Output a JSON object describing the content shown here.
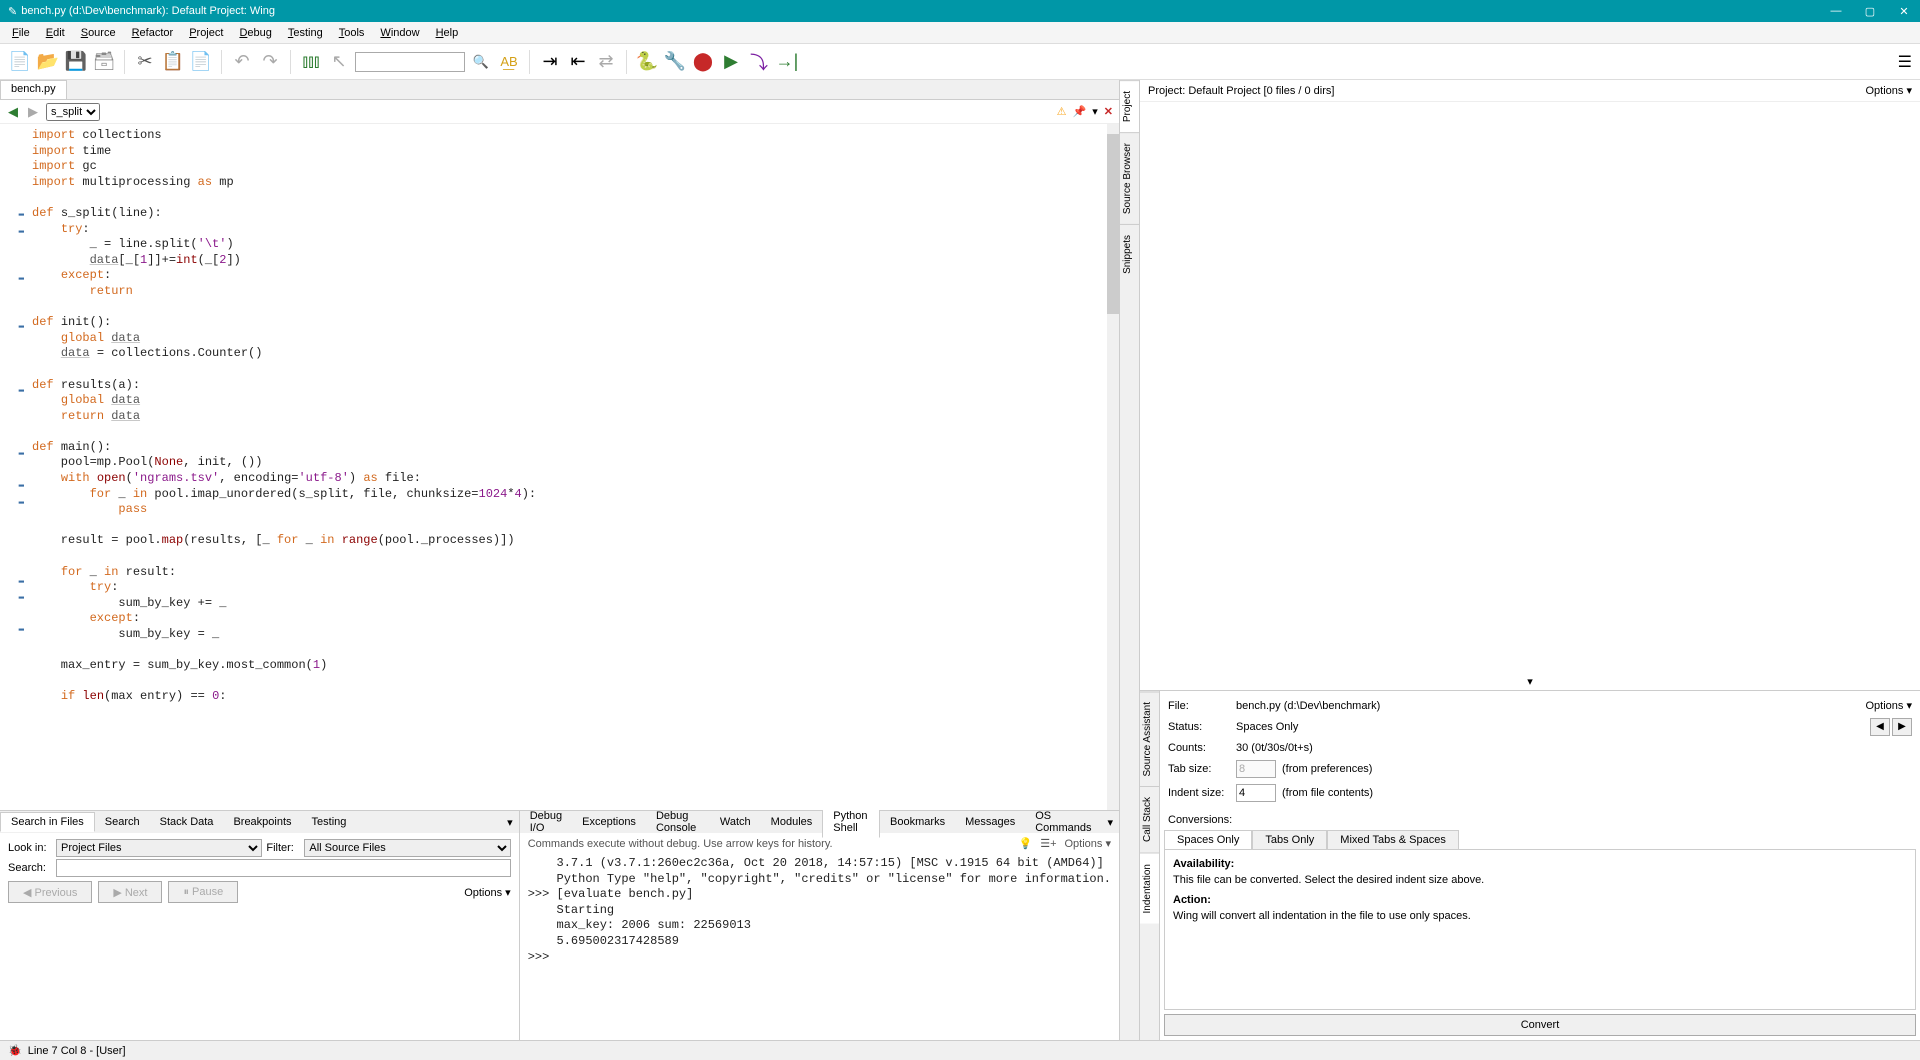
{
  "window": {
    "title": "bench.py (d:\\Dev\\benchmark): Default Project: Wing"
  },
  "menus": [
    "File",
    "Edit",
    "Source",
    "Refactor",
    "Project",
    "Debug",
    "Testing",
    "Tools",
    "Window",
    "Help"
  ],
  "filetab": "bench.py",
  "symbol_select": "s_split",
  "code_lines": [
    {
      "fold": "",
      "html": "<span class='kw'>import</span> collections"
    },
    {
      "fold": "",
      "html": "<span class='kw'>import</span> time"
    },
    {
      "fold": "",
      "html": "<span class='kw'>import</span> gc"
    },
    {
      "fold": "",
      "html": "<span class='kw'>import</span> multiprocessing <span class='kw'>as</span> mp"
    },
    {
      "fold": "",
      "html": ""
    },
    {
      "fold": "-",
      "html": "<span class='kw'>def</span> <span class='fn'>s_split</span>(line):"
    },
    {
      "fold": "-",
      "html": "    <span class='kw'>try</span>:"
    },
    {
      "fold": "",
      "html": "        _ = line.split(<span class='str'>'\\t'</span>)"
    },
    {
      "fold": "",
      "html": "        <span class='id'>data</span>[_[<span class='num'>1</span>]]+=<span class='kw2'>int</span>(_[<span class='num'>2</span>])"
    },
    {
      "fold": "-",
      "html": "    <span class='kw'>except</span>:"
    },
    {
      "fold": "",
      "html": "        <span class='kw'>return</span>"
    },
    {
      "fold": "",
      "html": ""
    },
    {
      "fold": "-",
      "html": "<span class='kw'>def</span> <span class='fn'>init</span>():"
    },
    {
      "fold": "",
      "html": "    <span class='kw'>global</span> <span class='id'>data</span>"
    },
    {
      "fold": "",
      "html": "    <span class='id'>data</span> = collections.Counter()"
    },
    {
      "fold": "",
      "html": ""
    },
    {
      "fold": "-",
      "html": "<span class='kw'>def</span> <span class='fn'>results</span>(a):"
    },
    {
      "fold": "",
      "html": "    <span class='kw'>global</span> <span class='id'>data</span>"
    },
    {
      "fold": "",
      "html": "    <span class='kw'>return</span> <span class='id'>data</span>"
    },
    {
      "fold": "",
      "html": ""
    },
    {
      "fold": "-",
      "html": "<span class='kw'>def</span> <span class='fn'>main</span>():"
    },
    {
      "fold": "",
      "html": "    pool=mp.Pool(<span class='kw2'>None</span>, init, ())"
    },
    {
      "fold": "-",
      "html": "    <span class='kw'>with</span> <span class='kw2'>open</span>(<span class='str'>'ngrams.tsv'</span>, encoding=<span class='str'>'utf-8'</span>) <span class='kw'>as</span> file:"
    },
    {
      "fold": "-",
      "html": "        <span class='kw'>for</span> _ <span class='kw'>in</span> pool.imap_unordered(s_split, file, chunksize=<span class='num'>1024</span>*<span class='num'>4</span>):"
    },
    {
      "fold": "",
      "html": "            <span class='kw'>pass</span>"
    },
    {
      "fold": "",
      "html": ""
    },
    {
      "fold": "",
      "html": "    result = pool.<span class='kw2'>map</span>(results, [_ <span class='kw'>for</span> _ <span class='kw'>in</span> <span class='kw2'>range</span>(pool._processes)])"
    },
    {
      "fold": "",
      "html": ""
    },
    {
      "fold": "-",
      "html": "    <span class='kw'>for</span> _ <span class='kw'>in</span> result:"
    },
    {
      "fold": "-",
      "html": "        <span class='kw'>try</span>:"
    },
    {
      "fold": "",
      "html": "            sum_by_key += _"
    },
    {
      "fold": "-",
      "html": "        <span class='kw'>except</span>:"
    },
    {
      "fold": "",
      "html": "            sum_by_key = _"
    },
    {
      "fold": "",
      "html": ""
    },
    {
      "fold": "",
      "html": "    max_entry = sum_by_key.most_common(<span class='num'>1</span>)"
    },
    {
      "fold": "",
      "html": ""
    },
    {
      "fold": "",
      "html": "    <span class='kw'>if</span> <span class='kw2'>len</span>(max entry) == <span class='num'>0</span>:"
    }
  ],
  "left_tabs": [
    "Search in Files",
    "Search",
    "Stack Data",
    "Breakpoints",
    "Testing"
  ],
  "left_active": 0,
  "look_in": "Project Files",
  "filter": "All Source Files",
  "search_val": "",
  "btn_prev": "Previous",
  "btn_next": "Next",
  "btn_pause": "Pause",
  "options": "Options",
  "right_tabs": [
    "Debug I/O",
    "Exceptions",
    "Debug Console",
    "Watch",
    "Modules",
    "Python Shell",
    "Bookmarks",
    "Messages",
    "OS Commands"
  ],
  "right_active": 5,
  "shell_hint": "Commands execute without debug.  Use arrow keys for history.",
  "shell_lines": [
    "    3.7.1 (v3.7.1:260ec2c36a, Oct 20 2018, 14:57:15) [MSC v.1915 64 bit (AMD64)]",
    "    Python Type \"help\", \"copyright\", \"credits\" or \"license\" for more information.",
    ">>> [evaluate bench.py]",
    "    Starting",
    "    max_key: 2006 sum: 22569013",
    "    5.695002317428589",
    ">>> "
  ],
  "proj_hdr": "Project: Default Project [0 files / 0 dirs]",
  "vtabs_top": [
    "Project",
    "Source Browser",
    "Snippets"
  ],
  "vtabs_bot": [
    "Source Assistant",
    "Call Stack",
    "Indentation"
  ],
  "vtab_bot_active": 2,
  "sa": {
    "file_lbl": "File:",
    "file_val": "bench.py (d:\\Dev\\benchmark)",
    "status_lbl": "Status:",
    "status_val": "Spaces Only",
    "counts_lbl": "Counts:",
    "counts_val": "30 (0t/30s/0t+s)",
    "tab_lbl": "Tab size:",
    "tab_val": "8",
    "tab_note": "(from preferences)",
    "indent_lbl": "Indent size:",
    "indent_val": "4",
    "indent_note": "(from file contents)"
  },
  "conversions_lbl": "Conversions:",
  "conv_tabs": [
    "Spaces Only",
    "Tabs Only",
    "Mixed Tabs & Spaces"
  ],
  "conv_active": 0,
  "avail_h": "Availability:",
  "avail_txt": "This file can be converted. Select the desired indent size above.",
  "action_h": "Action:",
  "action_txt": "Wing will convert all indentation in the file to use only spaces.",
  "convert_btn": "Convert",
  "status": "Line 7 Col 8 - [User]"
}
